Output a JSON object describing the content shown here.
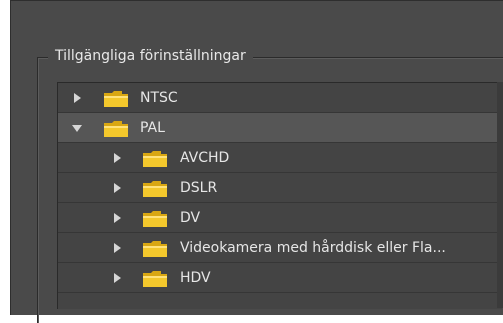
{
  "group": {
    "label": "Tillgängliga förinställningar"
  },
  "colors": {
    "panel": "#4a4a4a",
    "tree_bg": "#444444",
    "selected_row": "#565656",
    "folder_yellow": "#f4c82c",
    "text": "#e6e6e6"
  },
  "tree": {
    "items": [
      {
        "label": "NTSC",
        "expanded": false,
        "selected": false,
        "level": 0,
        "icon": "folder-icon"
      },
      {
        "label": "PAL",
        "expanded": true,
        "selected": true,
        "level": 0,
        "icon": "folder-icon"
      },
      {
        "label": "AVCHD",
        "expanded": false,
        "selected": false,
        "level": 1,
        "icon": "folder-icon"
      },
      {
        "label": "DSLR",
        "expanded": false,
        "selected": false,
        "level": 1,
        "icon": "folder-icon"
      },
      {
        "label": "DV",
        "expanded": false,
        "selected": false,
        "level": 1,
        "icon": "folder-icon"
      },
      {
        "label": "Videokamera med hårddisk eller Fla...",
        "expanded": false,
        "selected": false,
        "level": 1,
        "icon": "folder-icon"
      },
      {
        "label": "HDV",
        "expanded": false,
        "selected": false,
        "level": 1,
        "icon": "folder-icon"
      }
    ]
  }
}
